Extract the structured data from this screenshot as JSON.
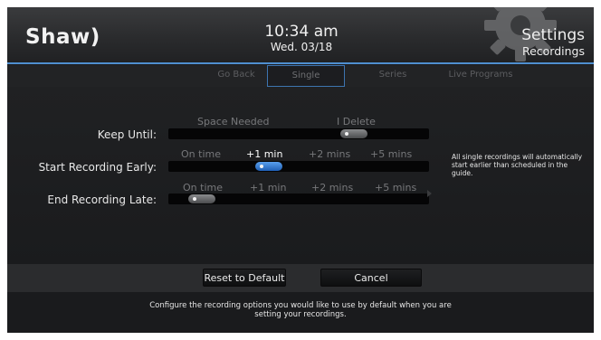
{
  "header": {
    "logo": "Shaw)",
    "time": "10:34 am",
    "date": "Wed. 03/18",
    "title": "Settings",
    "subtitle": "Recordings",
    "accent_color": "#4f8fd0",
    "decoration_icon": "gear-icon"
  },
  "tabs": [
    {
      "label": "Go Back",
      "active": false
    },
    {
      "label": "Single",
      "active": true
    },
    {
      "label": "Series",
      "active": false
    },
    {
      "label": "Live Programs",
      "active": false
    }
  ],
  "settings": [
    {
      "label": "Keep Until:",
      "options": [
        "Space Needed",
        "I Delete"
      ],
      "selected_index": 1,
      "focused": false
    },
    {
      "label": "Start Recording Early:",
      "options": [
        "On time",
        "+1 min",
        "+2 mins",
        "+5 mins"
      ],
      "selected_index": 1,
      "focused": true
    },
    {
      "label": "End Recording Late:",
      "options": [
        "On time",
        "+1 min",
        "+2 mins",
        "+5 mins"
      ],
      "selected_index": 0,
      "focused": false
    }
  ],
  "info_text": "All single recordings will automatically start earlier than scheduled in the guide.",
  "buttons": {
    "reset": "Reset to Default",
    "cancel": "Cancel"
  },
  "help_text_line1": "Configure the recording options you would like to use by default when you are",
  "help_text_line2": "setting your recordings.",
  "colors": {
    "focus_knob": "#2f7ad8",
    "background": "#1b1c1e"
  }
}
